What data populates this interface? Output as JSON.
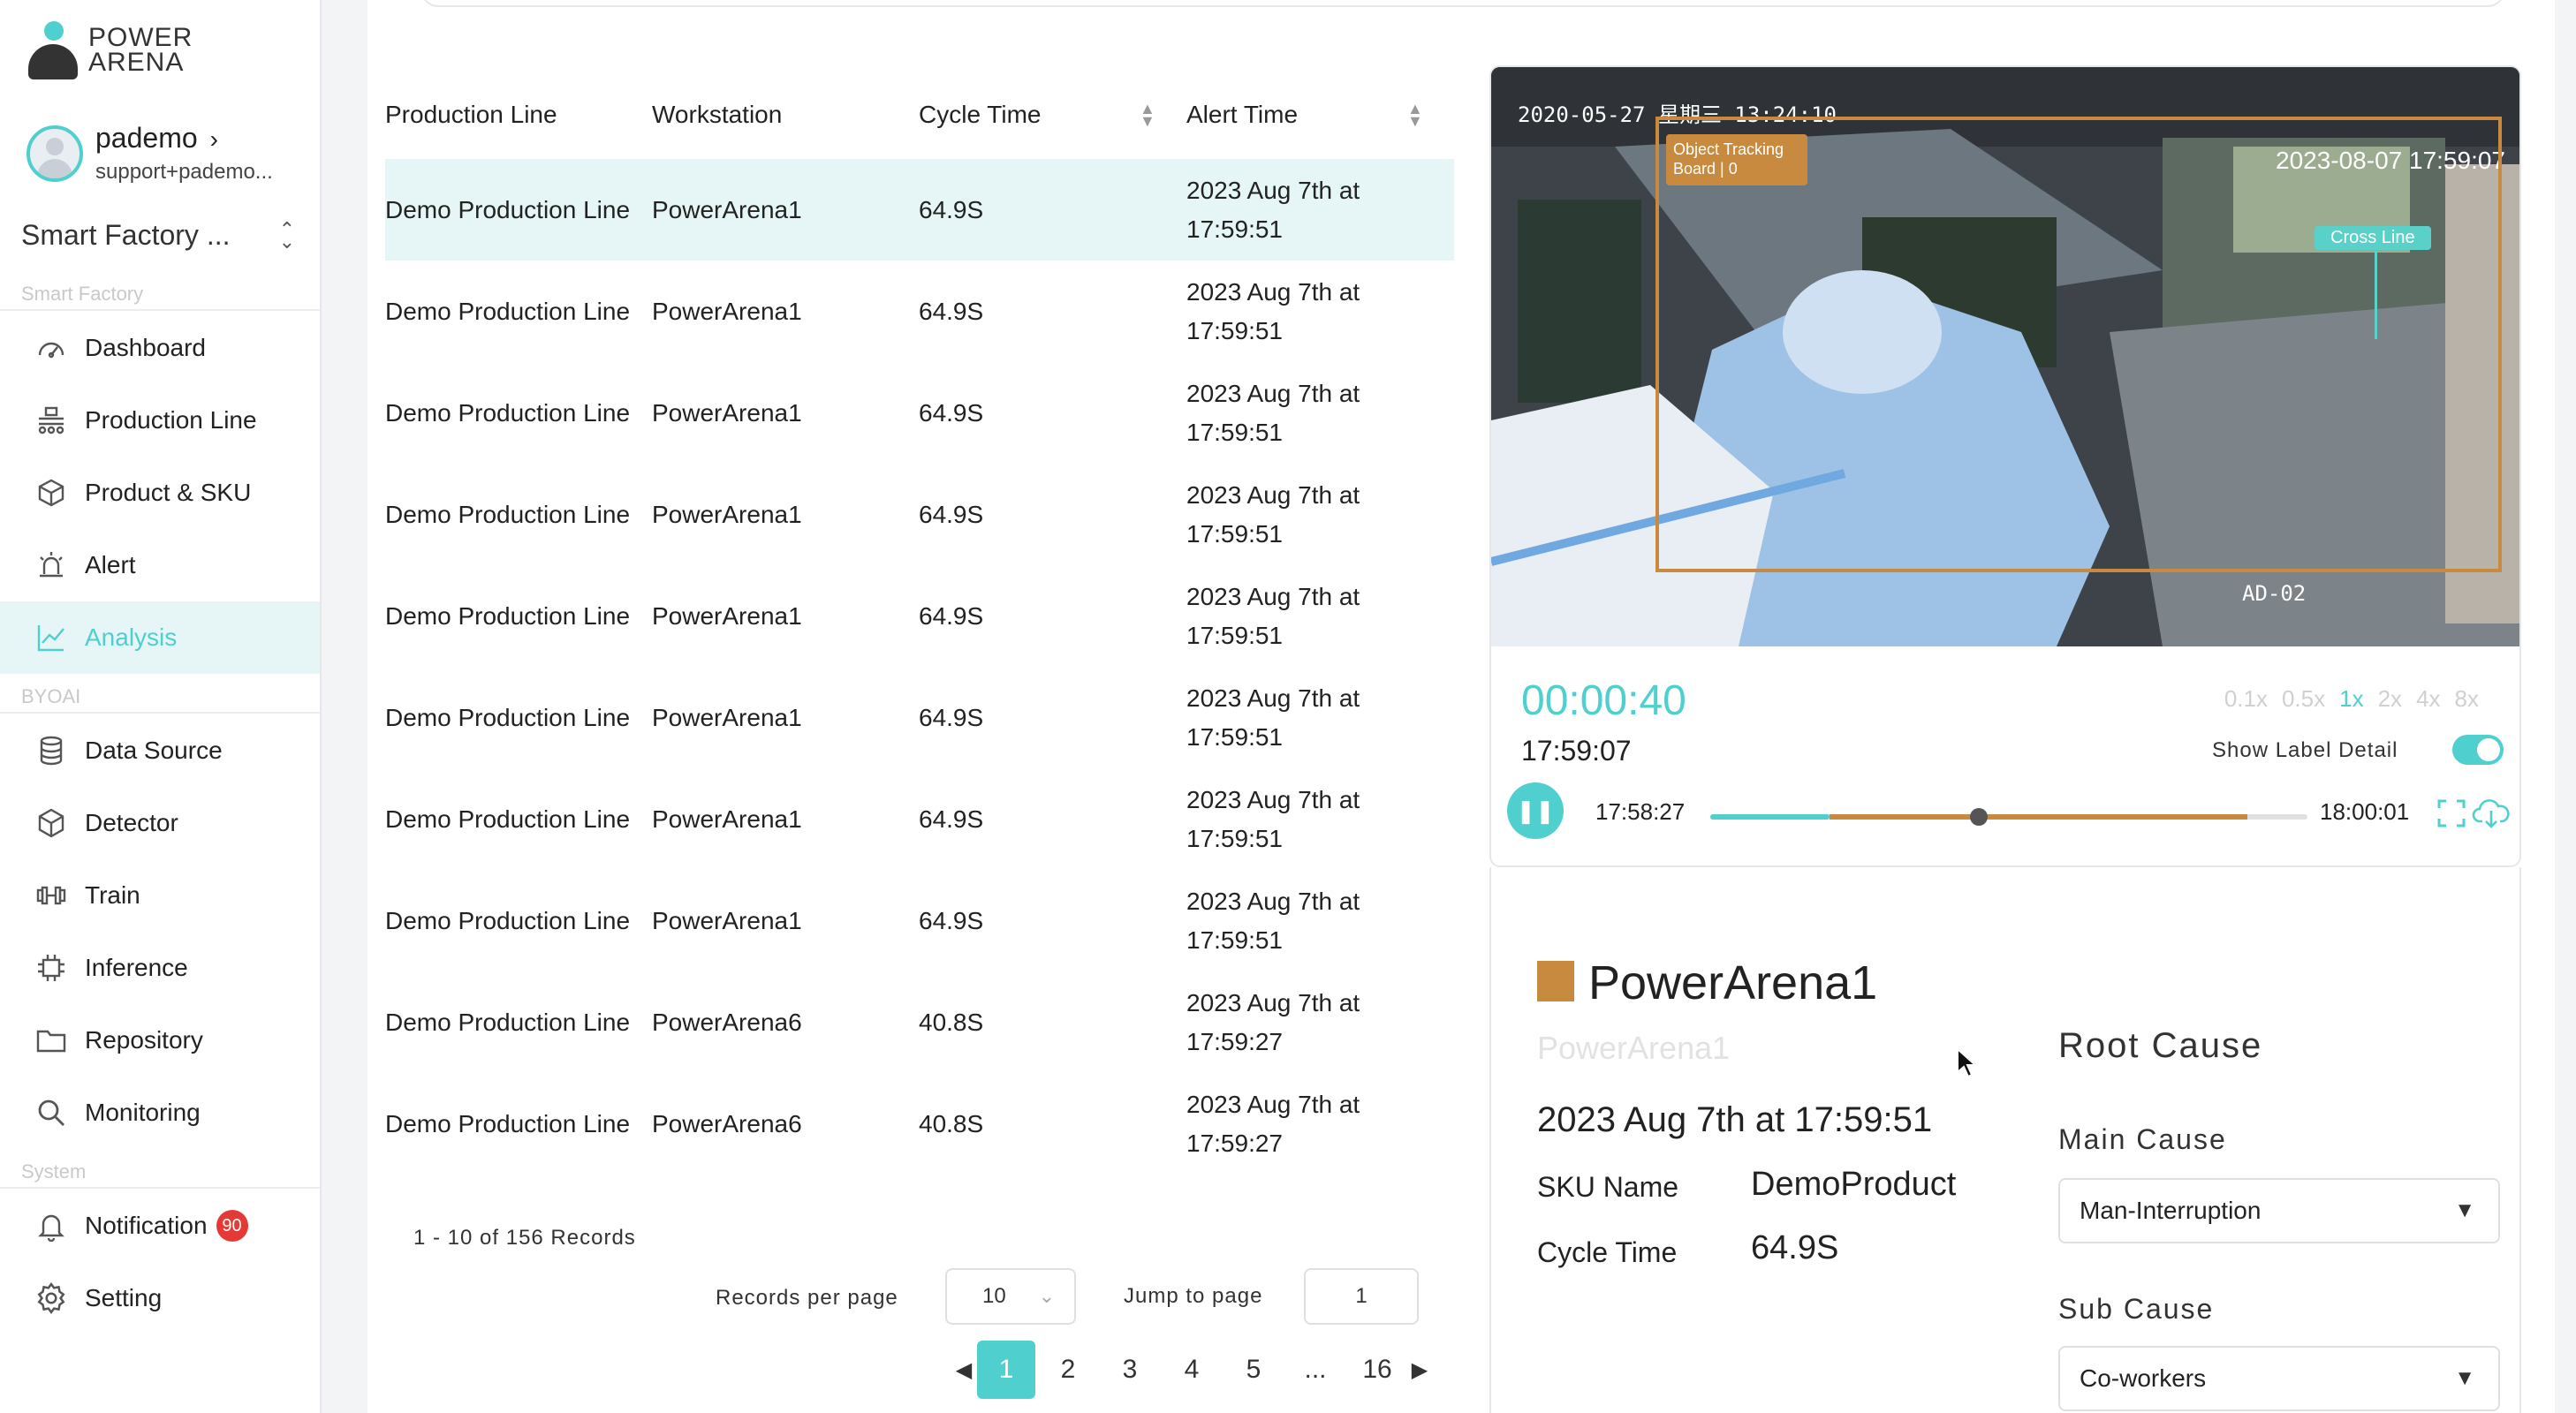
{
  "brand": {
    "line1": "POWER",
    "line2": "ARENA"
  },
  "user": {
    "name": "pademo",
    "email": "support+pademo..."
  },
  "factory": {
    "name": "Smart Factory ..."
  },
  "sidebar": {
    "sections": {
      "smart_factory": "Smart Factory",
      "byoai": "BYOAI",
      "system": "System"
    },
    "items": [
      {
        "label": "Dashboard",
        "icon": "gauge-icon"
      },
      {
        "label": "Production Line",
        "icon": "conveyor-icon"
      },
      {
        "label": "Product & SKU",
        "icon": "box-icon"
      },
      {
        "label": "Alert",
        "icon": "alarm-icon"
      },
      {
        "label": "Analysis",
        "icon": "chart-line-icon",
        "active": true
      },
      {
        "label": "Data Source",
        "icon": "database-icon"
      },
      {
        "label": "Detector",
        "icon": "cube-icon"
      },
      {
        "label": "Train",
        "icon": "dumbbell-icon"
      },
      {
        "label": "Inference",
        "icon": "chip-icon"
      },
      {
        "label": "Repository",
        "icon": "folder-icon"
      },
      {
        "label": "Monitoring",
        "icon": "magnifier-icon"
      },
      {
        "label": "Notification",
        "icon": "bell-icon",
        "badge": "90"
      },
      {
        "label": "Setting",
        "icon": "gear-icon"
      }
    ]
  },
  "table": {
    "headers": [
      "Production Line",
      "Workstation",
      "Cycle Time",
      "Alert Time"
    ],
    "rows": [
      {
        "line": "Demo Production Line",
        "ws": "PowerArena1",
        "cycle": "64.9S",
        "alert1": "2023 Aug 7th at",
        "alert2": "17:59:51"
      },
      {
        "line": "Demo Production Line",
        "ws": "PowerArena1",
        "cycle": "64.9S",
        "alert1": "2023 Aug 7th at",
        "alert2": "17:59:51"
      },
      {
        "line": "Demo Production Line",
        "ws": "PowerArena1",
        "cycle": "64.9S",
        "alert1": "2023 Aug 7th at",
        "alert2": "17:59:51"
      },
      {
        "line": "Demo Production Line",
        "ws": "PowerArena1",
        "cycle": "64.9S",
        "alert1": "2023 Aug 7th at",
        "alert2": "17:59:51"
      },
      {
        "line": "Demo Production Line",
        "ws": "PowerArena1",
        "cycle": "64.9S",
        "alert1": "2023 Aug 7th at",
        "alert2": "17:59:51"
      },
      {
        "line": "Demo Production Line",
        "ws": "PowerArena1",
        "cycle": "64.9S",
        "alert1": "2023 Aug 7th at",
        "alert2": "17:59:51"
      },
      {
        "line": "Demo Production Line",
        "ws": "PowerArena1",
        "cycle": "64.9S",
        "alert1": "2023 Aug 7th at",
        "alert2": "17:59:51"
      },
      {
        "line": "Demo Production Line",
        "ws": "PowerArena1",
        "cycle": "64.9S",
        "alert1": "2023 Aug 7th at",
        "alert2": "17:59:51"
      },
      {
        "line": "Demo Production Line",
        "ws": "PowerArena6",
        "cycle": "40.8S",
        "alert1": "2023 Aug 7th at",
        "alert2": "17:59:27"
      },
      {
        "line": "Demo Production Line",
        "ws": "PowerArena6",
        "cycle": "40.8S",
        "alert1": "2023 Aug 7th at",
        "alert2": "17:59:27"
      }
    ]
  },
  "pagination": {
    "records": "1 - 10 of 156 Records",
    "rpp_label": "Records per page",
    "rpp_value": "10",
    "jump_label": "Jump to page",
    "jump_value": "1",
    "pages": [
      "1",
      "2",
      "3",
      "4",
      "5",
      "...",
      "16"
    ],
    "current": "1"
  },
  "video": {
    "overlay_ts": "2020-05-27 星期三 13:24:10",
    "overlay_ts2": "2023-08-07 17:59:07",
    "tag_line1": "Object Tracking",
    "tag_line2": "Board | 0",
    "cross_label": "Cross Line",
    "camera": "AD-02",
    "elapsed": "00:00:40",
    "clock": "17:59:07",
    "speeds": [
      "0.1x",
      "0.5x",
      "1x",
      "2x",
      "4x",
      "8x"
    ],
    "speed_selected": "1x",
    "show_label": "Show Label Detail",
    "show_label_on": true,
    "start": "17:58:27",
    "end": "18:00:01",
    "progress": 0.2,
    "range_end": 0.9
  },
  "detail": {
    "title": "PowerArena1",
    "subtitle": "PowerArena1",
    "time": "2023 Aug 7th at 17:59:51",
    "sku_label": "SKU Name",
    "sku_value": "DemoProduct",
    "cycle_label": "Cycle Time",
    "cycle_value": "64.9S",
    "swatch_color": "#c88a3e"
  },
  "root_cause": {
    "title": "Root Cause",
    "main_label": "Main Cause",
    "main_value": "Man-Interruption",
    "sub_label": "Sub Cause",
    "sub_value": "Co-workers"
  },
  "colors": {
    "accent": "#4fcfcd",
    "marker": "#c88a3e",
    "badge": "#e53935"
  }
}
